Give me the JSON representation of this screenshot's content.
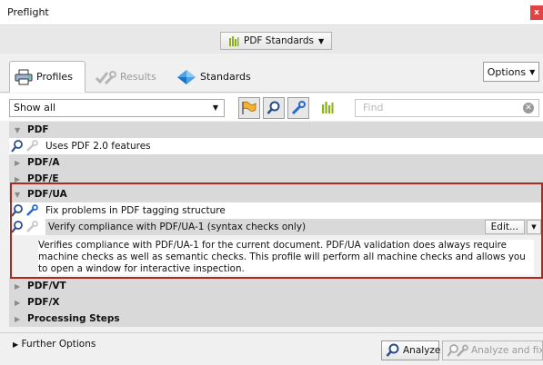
{
  "window": {
    "title": "Preflight",
    "close_label": "x"
  },
  "standards_dropdown": {
    "label": "PDF Standards",
    "icon": "bars-icon"
  },
  "tabs": [
    {
      "label": "Profiles",
      "icon": "printer-icon",
      "active": true
    },
    {
      "label": "Results",
      "icon": "wrench-check-icon",
      "active": false
    },
    {
      "label": "Standards",
      "icon": "diamond-icon",
      "active": false
    }
  ],
  "options_button": {
    "label": "Options"
  },
  "filter": {
    "show_value": "Show all",
    "find_placeholder": "Find",
    "tools": [
      "flag-icon",
      "magnifier-icon",
      "wrench-icon",
      "bars-icon"
    ]
  },
  "tree": {
    "pdf_group": "PDF",
    "pdf_item_1": "Uses PDF 2.0 features",
    "pdfa_group": "PDF/A",
    "pdfe_group": "PDF/E",
    "pdfua_group": "PDF/UA",
    "pdfua_item_1": "Fix problems in PDF tagging structure",
    "pdfua_item_2": "Verify compliance with PDF/UA-1 (syntax checks only)",
    "edit_label": "Edit...",
    "pdfua_item_2_description": "Verifies compliance with PDF/UA-1 for the current document. PDF/UA validation does always require machine checks as well as semantic checks. This profile will perform all machine checks and allows you to open a window for interactive inspection.",
    "pdfvt_group": "PDF/VT",
    "pdfx_group": "PDF/X",
    "processing_group": "Processing Steps"
  },
  "bottom": {
    "further_options": "Further Options",
    "analyze": "Analyze",
    "analyze_and_fix": "Analyze and fix"
  },
  "colors": {
    "highlight": "#b3261e",
    "accent_green": "#8ab317",
    "close_red": "#e04343"
  }
}
